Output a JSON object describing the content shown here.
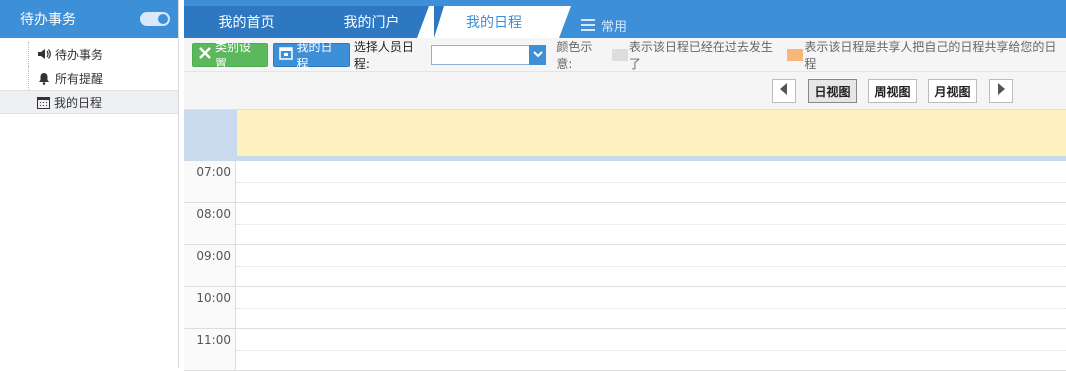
{
  "sidebar": {
    "title": "待办事务",
    "items": [
      {
        "label": "待办事务",
        "icon": "speaker-icon"
      },
      {
        "label": "所有提醒",
        "icon": "bell-icon"
      },
      {
        "label": "我的日程",
        "icon": "calendar-icon",
        "active": true
      }
    ]
  },
  "tabs": {
    "home": "我的首页",
    "portal": "我的门户",
    "schedule": "我的日程",
    "common": "常用"
  },
  "toolbar": {
    "category_btn": "类别设置",
    "my_schedule_btn": "我的日程",
    "select_person_label": "选择人员日程:",
    "select_value": "",
    "color_legend_label": "颜色示意:",
    "legend_past": "表示该日程已经在过去发生了",
    "legend_shared": "表示该日程是共享人把自己的日程共享给您的日程",
    "colors": {
      "past": "#dddddd",
      "shared": "#f5b87a"
    }
  },
  "viewbar": {
    "prev_icon": "triangle-left-icon",
    "day_view": "日视图",
    "week_view": "周视图",
    "month_view": "月视图",
    "next_icon": "triangle-right-icon",
    "active_view": "day"
  },
  "calendar": {
    "hours": [
      "07:00",
      "08:00",
      "09:00",
      "10:00",
      "11:00"
    ]
  },
  "colors": {
    "accent": "#3d8fd8",
    "allday_bg": "#fdf1bf",
    "green_btn": "#5cb85c"
  }
}
